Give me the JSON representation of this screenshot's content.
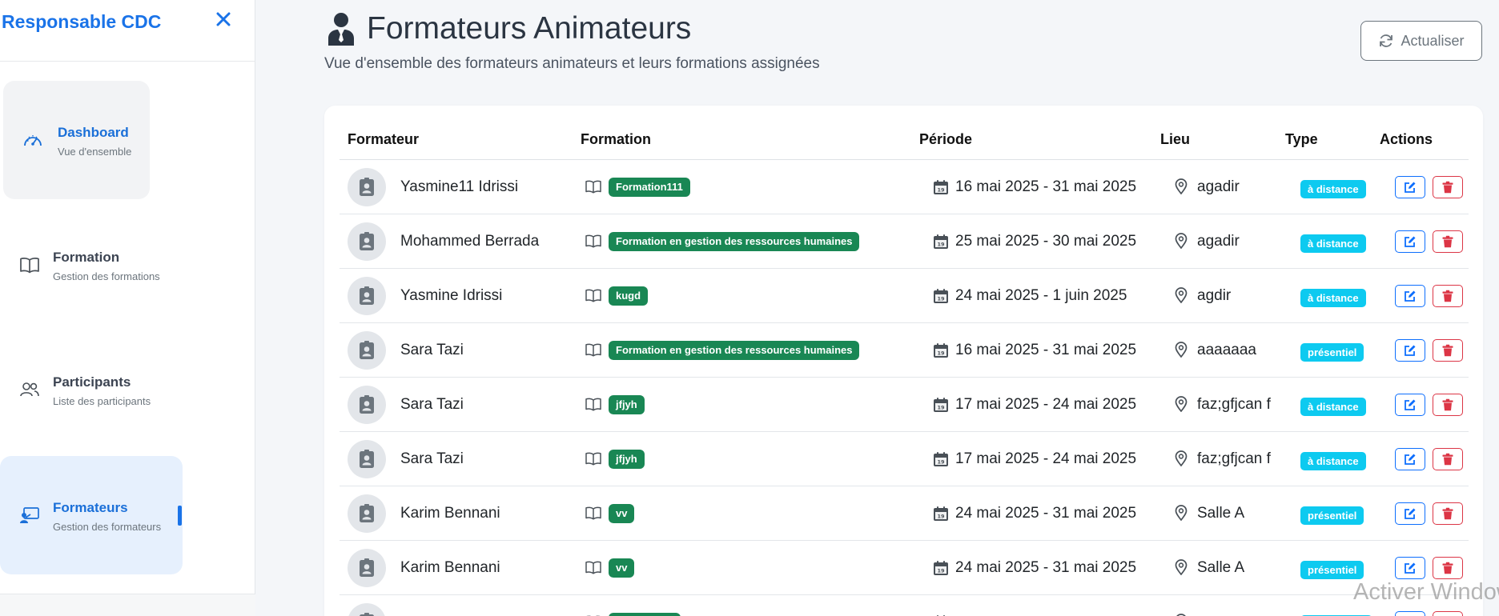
{
  "sidebar": {
    "title": "Responsable CDC",
    "items": [
      {
        "label": "Dashboard",
        "sub": "Vue d'ensemble"
      },
      {
        "label": "Formation",
        "sub": "Gestion des formations"
      },
      {
        "label": "Participants",
        "sub": "Liste des participants"
      },
      {
        "label": "Formateurs",
        "sub": "Gestion des formateurs"
      }
    ]
  },
  "page": {
    "title": "Formateurs Animateurs",
    "subtitle": "Vue d'ensemble des formateurs animateurs et leurs formations assignées",
    "refresh_label": "Actualiser"
  },
  "table": {
    "columns": [
      "Formateur",
      "Formation",
      "Période",
      "Lieu",
      "Type",
      "Actions"
    ],
    "rows": [
      {
        "formateur": "Yasmine11 Idrissi",
        "formation": "Formation111",
        "periode": "16 mai 2025 - 31 mai 2025",
        "lieu": "agadir",
        "type": "à distance"
      },
      {
        "formateur": "Mohammed Berrada",
        "formation": "Formation en gestion des ressources humaines",
        "periode": "25 mai 2025 - 30 mai 2025",
        "lieu": "agadir",
        "type": "à distance"
      },
      {
        "formateur": "Yasmine Idrissi",
        "formation": "kugd",
        "periode": "24 mai 2025 - 1 juin 2025",
        "lieu": "agdir",
        "type": "à distance"
      },
      {
        "formateur": "Sara Tazi",
        "formation": "Formation en gestion des ressources humaines",
        "periode": "16 mai 2025 - 31 mai 2025",
        "lieu": "aaaaaaa",
        "type": "présentiel"
      },
      {
        "formateur": "Sara Tazi",
        "formation": "jfjyh",
        "periode": "17 mai 2025 - 24 mai 2025",
        "lieu": "faz;gfjcan f",
        "type": "à distance"
      },
      {
        "formateur": "Sara Tazi",
        "formation": "jfjyh",
        "periode": "17 mai 2025 - 24 mai 2025",
        "lieu": "faz;gfjcan f",
        "type": "à distance"
      },
      {
        "formateur": "Karim Bennani",
        "formation": "vv",
        "periode": "24 mai 2025 - 31 mai 2025",
        "lieu": "Salle A",
        "type": "présentiel"
      },
      {
        "formateur": "Karim Bennani",
        "formation": "vv",
        "periode": "24 mai 2025 - 31 mai 2025",
        "lieu": "Salle A",
        "type": "présentiel"
      },
      {
        "formateur": "",
        "formation": "",
        "periode": "",
        "lieu": "",
        "type": ""
      }
    ]
  },
  "watermark": "Activer Windows",
  "colors": {
    "accent": "#1a73e8",
    "formation_badge": "#198754",
    "type_badge": "#0dcaf0",
    "edit": "#0d6efd",
    "delete": "#dc3545"
  },
  "icons": {
    "close": "close-icon",
    "dashboard": "speedometer-icon",
    "formation": "book-icon",
    "participants": "people-icon",
    "formateurs": "person-presentation-icon",
    "title": "person-suit-icon",
    "refresh": "refresh-icon",
    "avatar": "id-badge-icon",
    "calendar": "calendar-icon",
    "location": "map-pin-icon",
    "edit": "edit-icon",
    "delete": "trash-icon"
  }
}
